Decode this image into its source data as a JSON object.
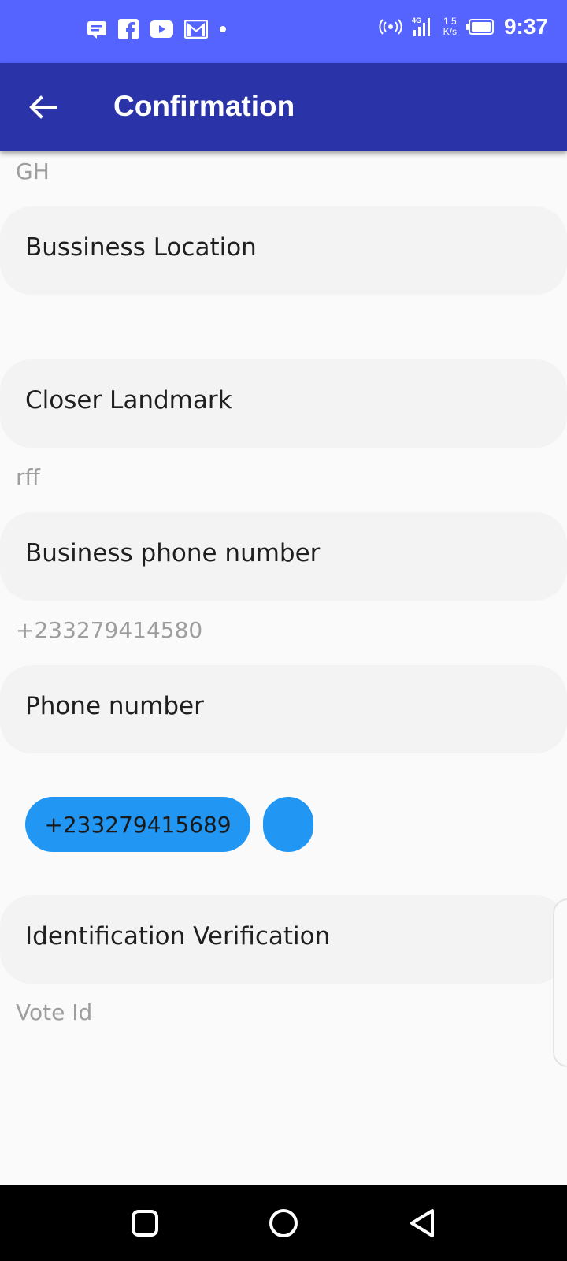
{
  "status_bar": {
    "time": "9:37",
    "speed_value": "1.5",
    "speed_unit": "K/s",
    "network": "4G",
    "left_icons": [
      "notification-icon",
      "facebook-icon",
      "youtube-icon",
      "gmail-icon",
      "dot-icon"
    ]
  },
  "app_bar": {
    "title": "Confirmation"
  },
  "fields": {
    "country_value": "GH",
    "business_location_label": "Bussiness Location",
    "business_location_value": "",
    "landmark_label": "Closer Landmark",
    "landmark_value": "rff",
    "business_phone_label": "Business phone number",
    "business_phone_value": "+233279414580",
    "phone_label": "Phone number",
    "phone_chip": "+233279415689",
    "id_label": "Identification Verification",
    "id_value": "Vote Id"
  },
  "colors": {
    "status_bar": "#5563ff",
    "app_bar": "#2a33a8",
    "chip": "#2196f3"
  }
}
